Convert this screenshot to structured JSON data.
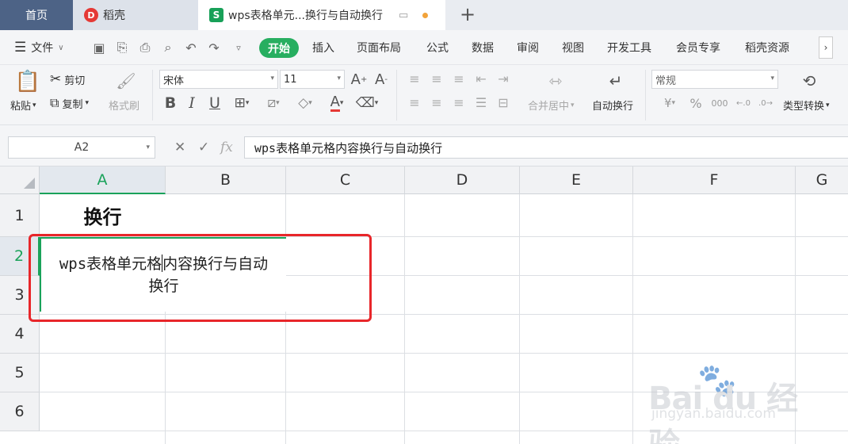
{
  "tabs": {
    "home": "首页",
    "daoke": "稻壳",
    "doc": "wps表格单元...换行与自动换行",
    "daoke_logo": "D",
    "doc_logo": "S"
  },
  "menu": {
    "file": "文件",
    "start": "开始",
    "items": [
      "插入",
      "页面布局",
      "公式",
      "数据",
      "审阅",
      "视图",
      "开发工具",
      "会员专享",
      "稻壳资源"
    ]
  },
  "ribbon": {
    "paste": "粘贴",
    "cut": "剪切",
    "copy": "复制",
    "format_painter": "格式刷",
    "font_name": "宋体",
    "font_size": "11",
    "merge_center": "合并居中",
    "wrap_text": "自动换行",
    "number_format": "常规",
    "type_convert": "类型转换"
  },
  "formula_bar": {
    "name_box": "A2",
    "fx_label": "fx",
    "content": "wps表格单元格内容换行与自动换行"
  },
  "grid": {
    "columns": [
      "A",
      "B",
      "C",
      "D",
      "E",
      "F",
      "G"
    ],
    "rows": [
      "1",
      "2",
      "3",
      "4",
      "5",
      "6"
    ],
    "active_column": "A",
    "active_row": "2",
    "a1": "换行",
    "a2_line1_before": "wps表格单元格",
    "a2_line1_after": "内容换行与自动",
    "a2_line2": "换行"
  },
  "watermark": {
    "brand": "Bai du 经验",
    "url": "jingyan.baidu.com"
  },
  "colors": {
    "accent_green": "#27ae60",
    "highlight_red": "#e8262a",
    "home_tab": "#4d6386"
  }
}
